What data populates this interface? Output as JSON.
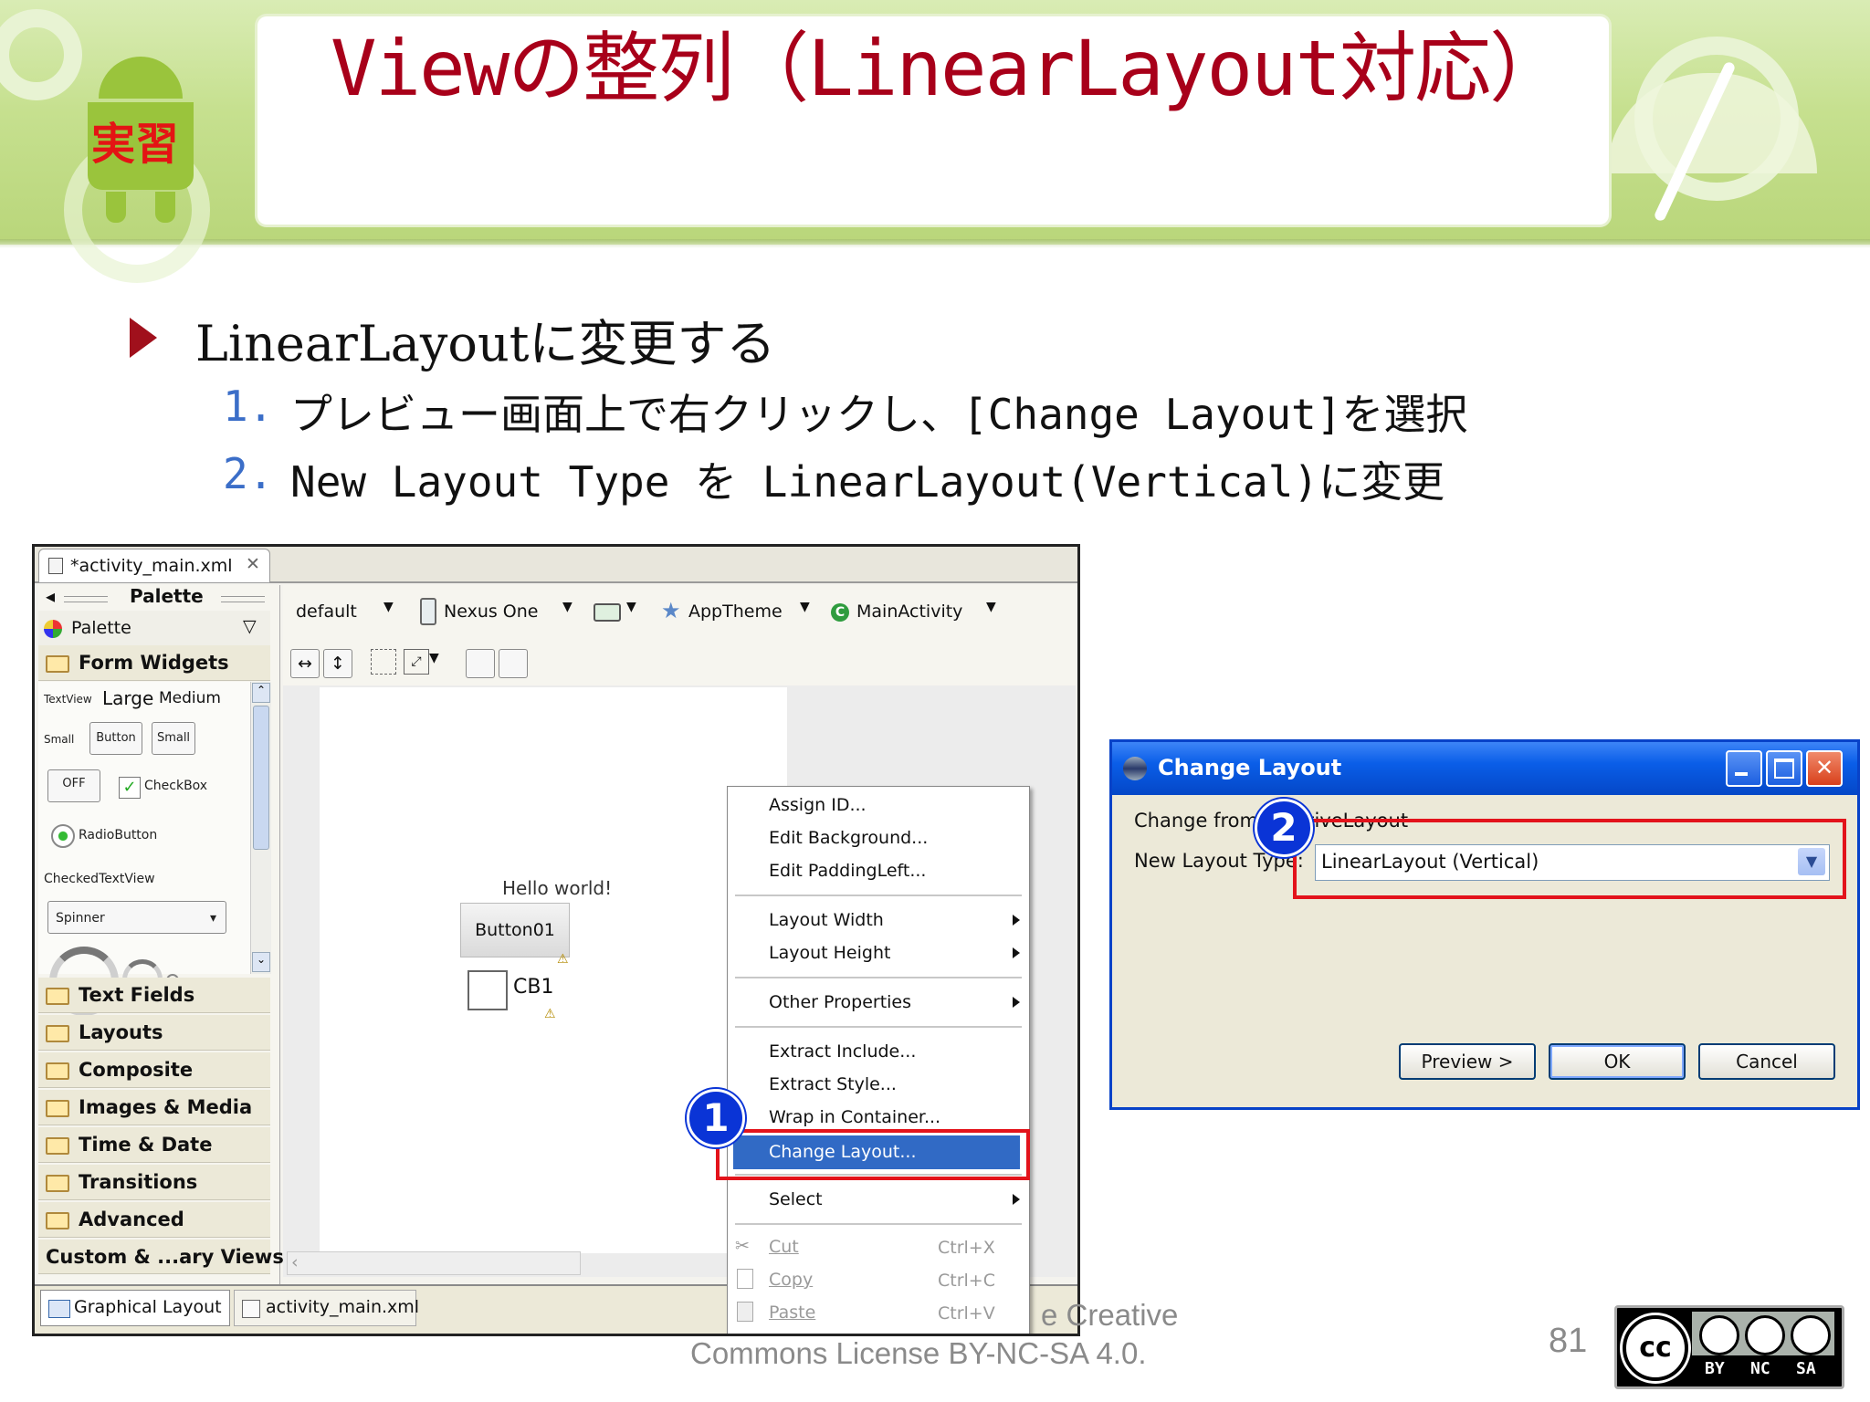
{
  "slide": {
    "title": "Viewの整列（LinearLayout対応）",
    "badge": "実習",
    "bullet": "LinearLayoutに変更する",
    "steps": [
      {
        "num": "1.",
        "text": "プレビュー画面上で右クリックし、[Change Layout]を選択"
      },
      {
        "num": "2.",
        "text": "New Layout Type を LinearLayout(Vertical)に変更"
      }
    ],
    "footer_line1": "e Creative",
    "footer_line2": "Commons License BY-NC-SA 4.0.",
    "page_number": "81",
    "license_badge": {
      "cc": "cc",
      "labels": [
        "BY",
        "NC",
        "SA"
      ]
    }
  },
  "eclipse": {
    "tab_title": "*activity_main.xml",
    "palette_header": "Palette",
    "palette_dropdown": "Palette",
    "categories_top": [
      "Form Widgets"
    ],
    "widgets": {
      "textview": "TextView",
      "large": "Large",
      "medium": "Medium",
      "small_label": "Small",
      "button": "Button",
      "small_btn": "Small",
      "off": "OFF",
      "checkbox": "CheckBox",
      "radio": "RadioButton",
      "checked_text": "CheckedTextView",
      "spinner": "Spinner"
    },
    "categories_bottom": [
      "Text Fields",
      "Layouts",
      "Composite",
      "Images & Media",
      "Time & Date",
      "Transitions",
      "Advanced",
      "Custom & ...ary Views"
    ],
    "toolbar": {
      "config": "default",
      "device": "Nexus One",
      "theme": "AppTheme",
      "activity": "MainActivity"
    },
    "preview": {
      "hello": "Hello world!",
      "button": "Button01",
      "checkbox": "CB1"
    },
    "bottom_tabs": [
      "Graphical Layout",
      "activity_main.xml"
    ],
    "context_menu": {
      "group1": [
        "Assign ID...",
        "Edit Background...",
        "Edit PaddingLeft..."
      ],
      "group2": [
        "Layout Width",
        "Layout Height"
      ],
      "group3": [
        "Other Properties"
      ],
      "group4": [
        "Extract Include...",
        "Extract Style...",
        "Wrap in Container..."
      ],
      "highlighted": "Change Layout...",
      "select": "Select",
      "edit": [
        {
          "label": "Cut",
          "shortcut": "Ctrl+X"
        },
        {
          "label": "Copy",
          "shortcut": "Ctrl+C"
        },
        {
          "label": "Paste",
          "shortcut": "Ctrl+V"
        }
      ]
    },
    "marker1": "1"
  },
  "dialog": {
    "title": "Change Layout",
    "change_from_label": "Change from:",
    "change_from_value": "RelativeLayout",
    "new_type_label": "New Layout Type:",
    "new_type_value": "LinearLayout (Vertical)",
    "buttons": {
      "preview": "Preview >",
      "ok": "OK",
      "cancel": "Cancel"
    },
    "marker2": "2"
  }
}
